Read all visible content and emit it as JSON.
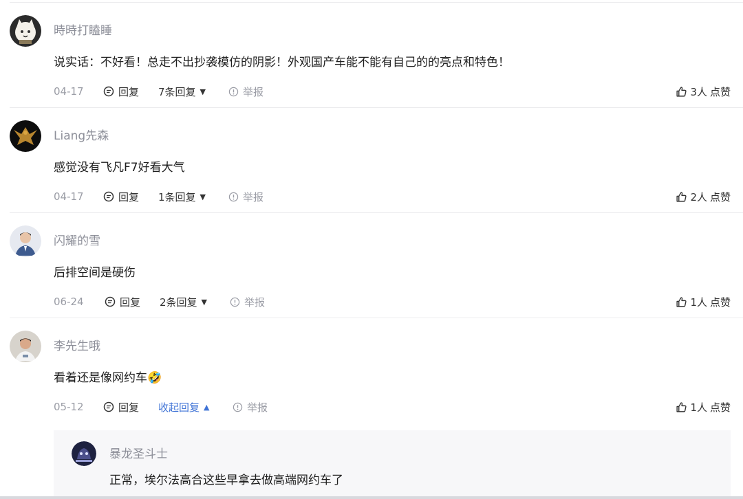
{
  "comments": [
    {
      "username": "時時打瞌睡",
      "text": "说实话：不好看！总走不出抄袭模仿的阴影！外观国产车能不能有自己的的亮点和特色！",
      "date": "04-17",
      "reply_label": "回复",
      "replies_label": "7条回复",
      "report_label": "举报",
      "likes_count": "3人",
      "likes_label": "点赞"
    },
    {
      "username": "Liang先森",
      "text": "感觉没有飞凡F7好看大气",
      "date": "04-17",
      "reply_label": "回复",
      "replies_label": "1条回复",
      "report_label": "举报",
      "likes_count": "2人",
      "likes_label": "点赞"
    },
    {
      "username": "闪耀的雪",
      "text": "后排空间是硬伤",
      "date": "06-24",
      "reply_label": "回复",
      "replies_label": "2条回复",
      "report_label": "举报",
      "likes_count": "1人",
      "likes_label": "点赞"
    },
    {
      "username": "李先生哦",
      "text": "看着还是像网约车🤣",
      "date": "05-12",
      "reply_label": "回复",
      "replies_label": "收起回复",
      "report_label": "举报",
      "likes_count": "1人",
      "likes_label": "点赞"
    }
  ],
  "sub_reply": {
    "username": "暴龙圣斗士",
    "text": "正常，埃尔法高合这些早拿去做高端网约车了"
  },
  "icons": {
    "reply": "reply-bubble-icon",
    "report": "info-circle-icon",
    "like": "thumbs-up-icon",
    "expand": "caret-down-icon",
    "collapse": "caret-up-icon"
  },
  "colors": {
    "link_blue": "#3f73d6",
    "muted": "#9a9ca5"
  }
}
